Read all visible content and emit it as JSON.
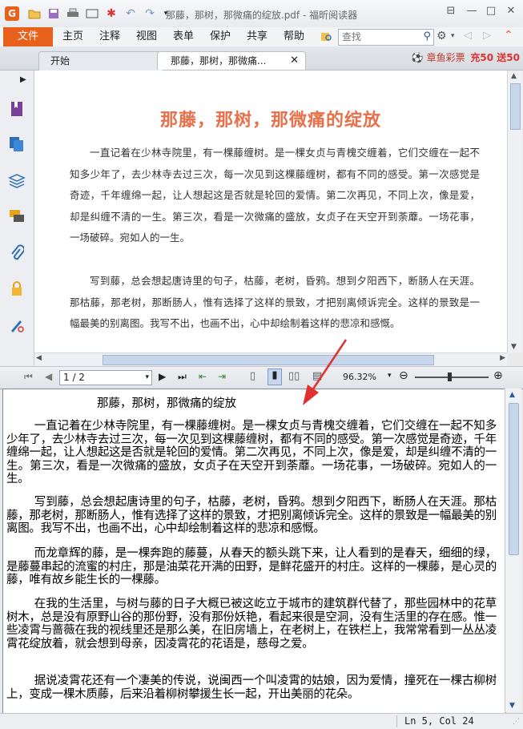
{
  "window": {
    "title": "那藤，那树，那微痛的绽放.pdf - 福昕阅读器",
    "minimize": "—",
    "restore": "□",
    "close": "✕"
  },
  "menu": {
    "file": "文件",
    "items": [
      "主页",
      "注释",
      "视图",
      "表单",
      "保护",
      "共享",
      "帮助"
    ],
    "search_placeholder": "查找"
  },
  "tabs": {
    "start": "开始",
    "doc": "那藤，那树，那微痛...",
    "ad": "章鱼彩票",
    "ad_promo": "充50 送50"
  },
  "doc": {
    "title": "那藤，那树，那微痛的绽放",
    "para1": "一直记着在少林寺院里，有一棵藤缠树。是一棵女贞与青槐交缠着，它们交缠在一起不知多少年了，去少林寺去过三次，每一次见到这棵藤缠树，都有不同的感受。第一次感觉是奇迹，千年缠绵一起，让人想起这是否就是轮回的爱情。第二次再见，不同上次，像是爱，却是纠缠不清的一生。第三次，看是一次微痛的盛放，女贞子在天空开到荼蘼。一场花事，一场破碎。宛如人的一生。",
    "para2": "写到藤，总会想起唐诗里的句子，枯藤，老树，昏鸦。想到夕阳西下，断肠人在天涯。那枯藤，那老树，那断肠人，惟有选择了这样的景致，才把别离倾诉完全。这样的景致是一幅最美的别离图。我写不出，也画不出，心中却绘制着这样的悲凉和感慨。"
  },
  "nav": {
    "page": "1 / 2",
    "zoom": "96.32%"
  },
  "editor": {
    "title": "那藤，那树，那微痛的绽放",
    "paragraphs": [
      "一直记着在少林寺院里，有一棵藤缠树。是一棵女贞与青槐交缠着，它们交缠在一起不知多少年了，去少林寺去过三次，每一次见到这棵藤缠树，都有不同的感受。第一次感觉是奇迹，千年缠绵一起，让人想起这是否就是轮回的爱情。第二次再见，不同上次，像是爱，却是纠缠不清的一生。第三次，看是一次微痛的盛放，女贞子在天空开到荼蘼。一场花事，一场破碎。宛如人的一生。",
      "写到藤，总会想起唐诗里的句子，枯藤，老树，昏鸦。想到夕阳西下，断肠人在天涯。那枯藤，那老树，那断肠人，惟有选择了这样的景致，才把别离倾诉完全。这样的景致是一幅最美的别离图。我写不出，也画不出，心中却绘制着这样的悲凉和感慨。",
      "而龙章辉的藤，是一棵奔跑的藤蔓，从春天的额头跳下来，让人看到的是春天，细细的绿，是藤蔓串起的流蜜的村庄，那是油菜花开满的田野，是鲜花盛开的村庄。这样的一棵藤，是心灵的藤，唯有故乡能生长的一棵藤。",
      "在我的生活里，与树与藤的日子大概已被这屹立于城市的建筑群代替了，那些园林中的花草树木，总是没有原野山谷的那份野，没有那份妖艳，看起来很是空洞，没有生活里的存在感。惟一些凌霄与蔷薇在我的视线里还是那么美，在旧房墙上，在老树上，在铁栏上，我常常看到一丛丛凌霄花绽放着，就会想到母亲，因凌霄花的花语是，慈母之爱。",
      "据说凌霄花还有一个凄美的传说，说闽西一个叫凌霄的姑娘，因为爱情，撞死在一棵古柳树上，变成一棵木质藤，后来沿着柳树攀援生长一起，开出美丽的花朵。"
    ],
    "status": "Ln 5, Col 24"
  },
  "colors": {
    "accent": "#e8611c",
    "doc_title": "#e8704a",
    "arrow": "#e03131"
  }
}
